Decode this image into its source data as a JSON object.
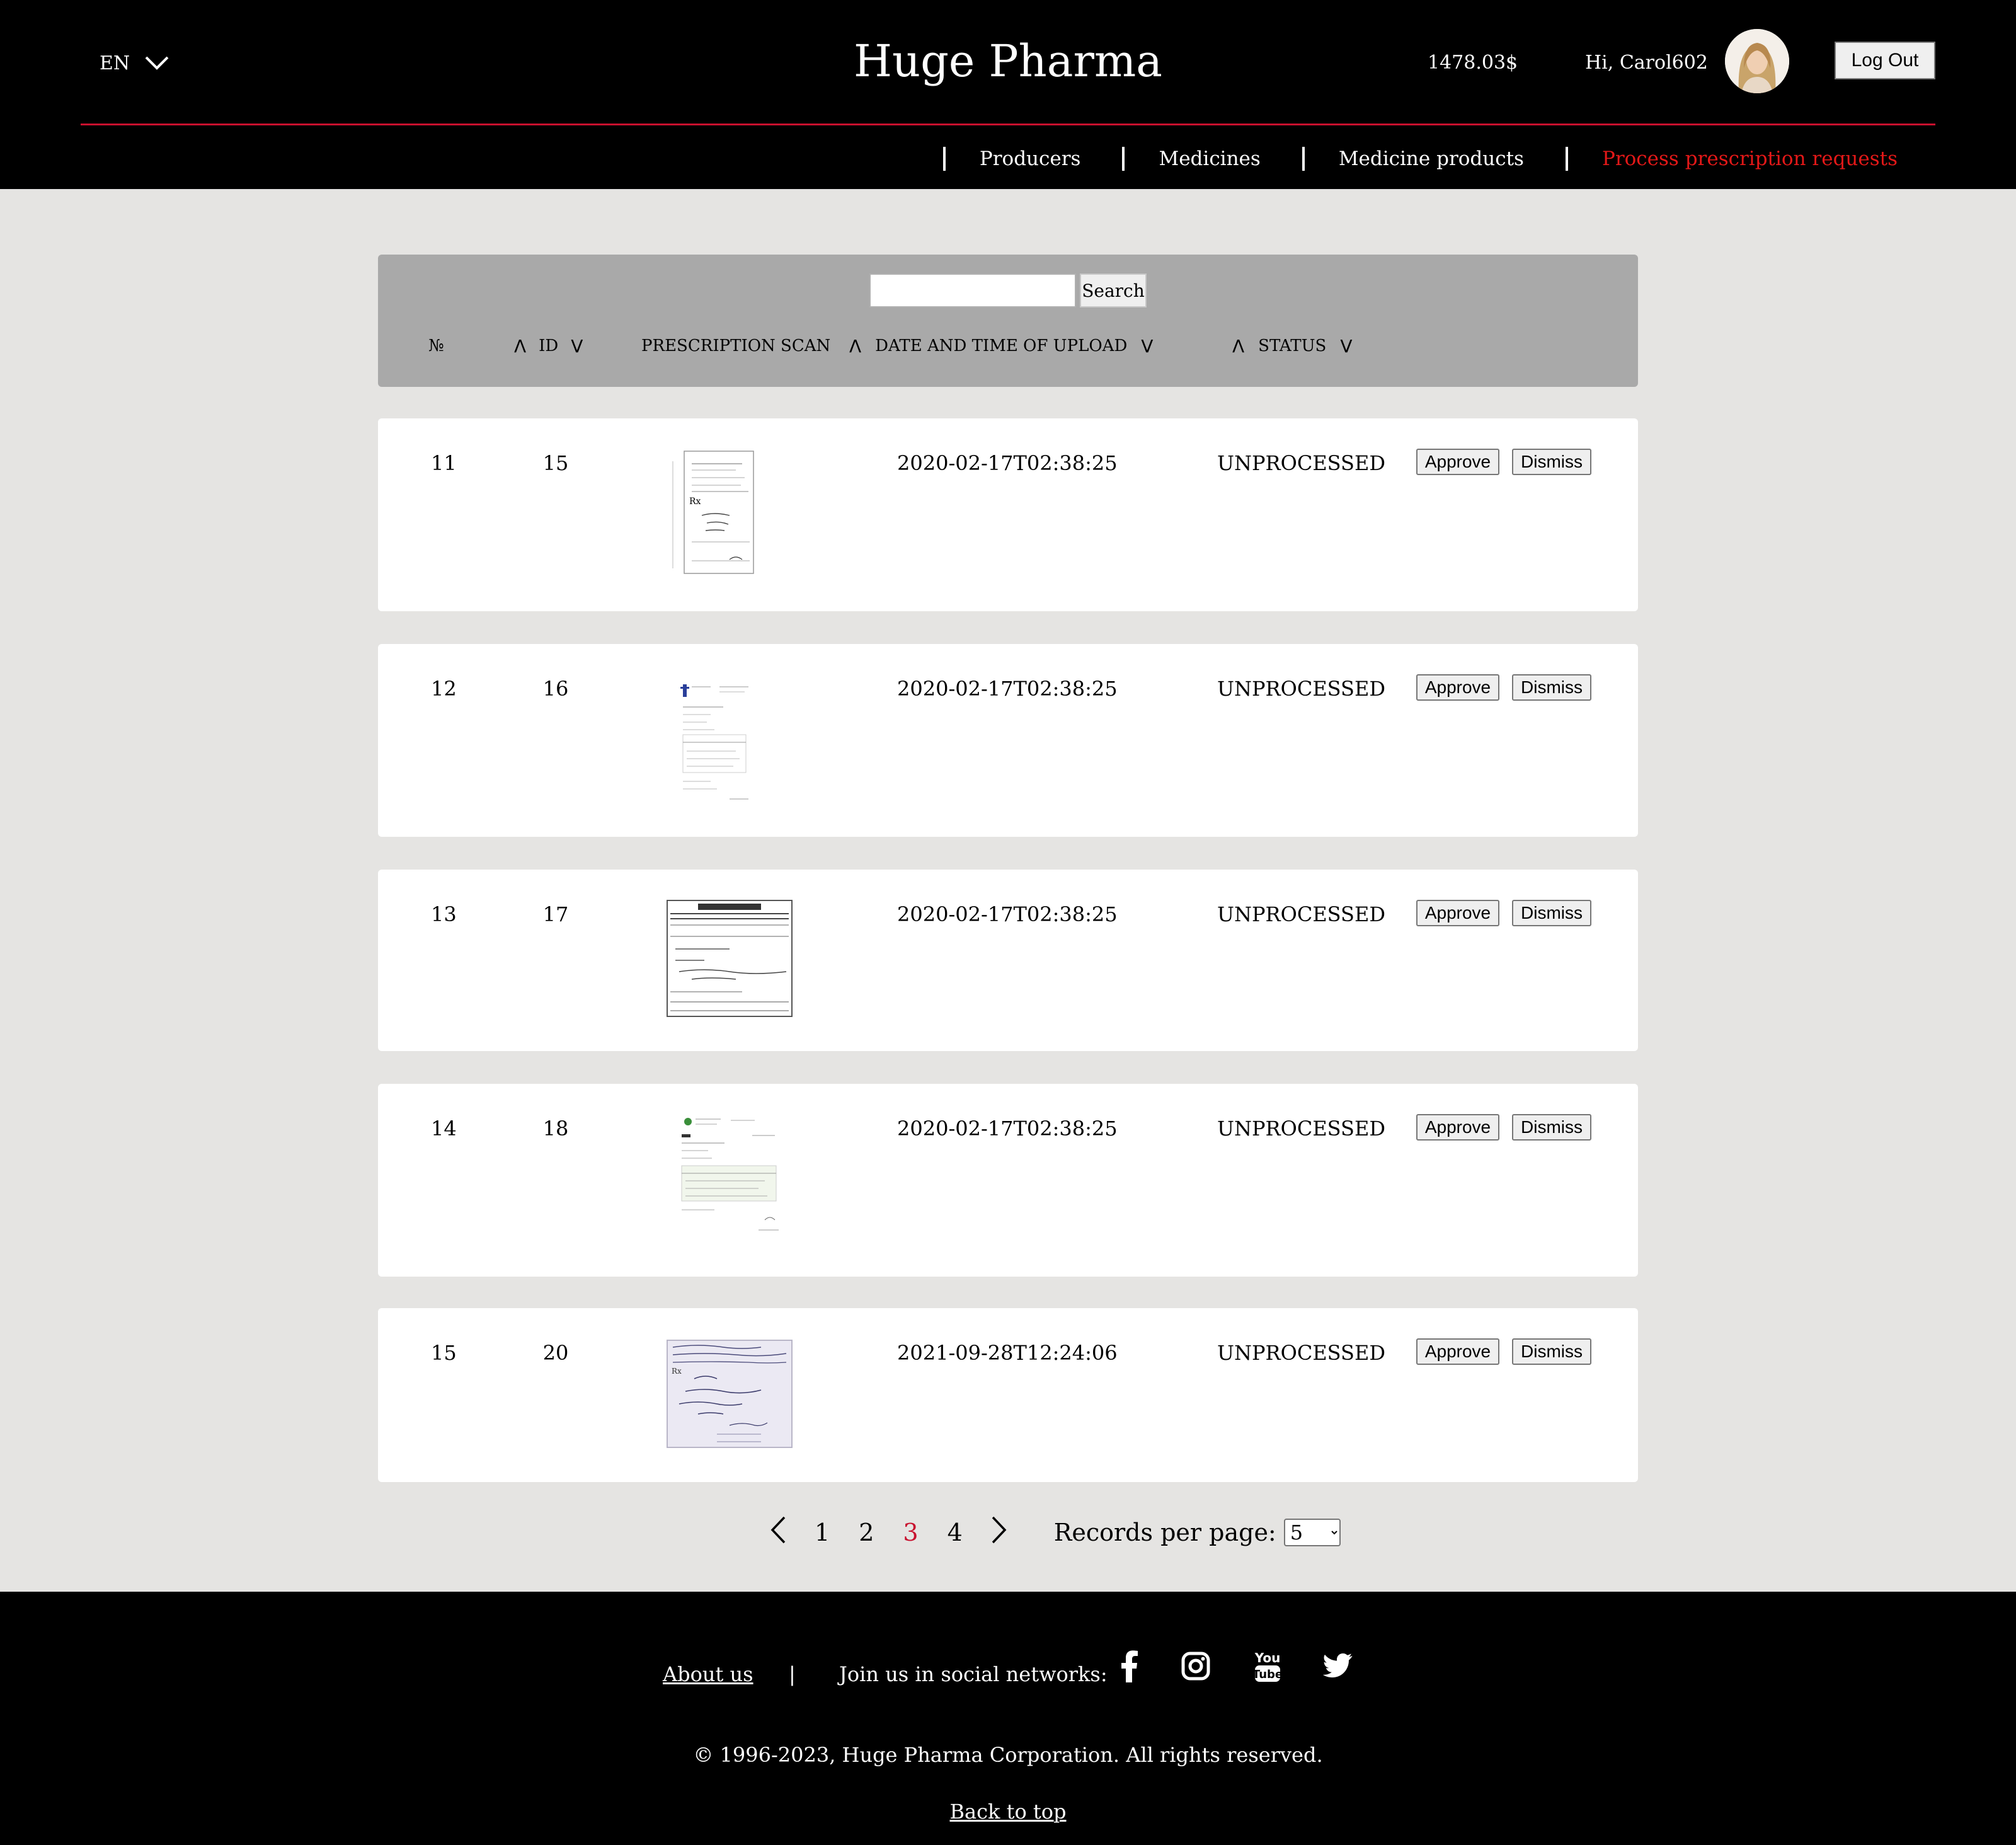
{
  "header": {
    "language": "EN",
    "brand": "Huge Pharma",
    "balance": "1478.03$",
    "greeting": "Hi, Carol602",
    "logout_label": "Log Out"
  },
  "nav": {
    "items": [
      {
        "label": "Producers"
      },
      {
        "label": "Medicines"
      },
      {
        "label": "Medicine products"
      },
      {
        "label": "Process prescription requests",
        "active": true
      }
    ]
  },
  "search": {
    "value": "",
    "button_label": "Search"
  },
  "table": {
    "columns": {
      "no": "№",
      "id": "ID",
      "scan": "PRESCRIPTION SCAN",
      "date": "DATE AND TIME OF UPLOAD",
      "status": "STATUS"
    },
    "sort_up_glyph": "Λ",
    "sort_down_glyph": "V",
    "approve_label": "Approve",
    "dismiss_label": "Dismiss",
    "rows": [
      {
        "no": "11",
        "id": "15",
        "uploaded": "2020-02-17T02:38:25",
        "status": "UNPROCESSED"
      },
      {
        "no": "12",
        "id": "16",
        "uploaded": "2020-02-17T02:38:25",
        "status": "UNPROCESSED"
      },
      {
        "no": "13",
        "id": "17",
        "uploaded": "2020-02-17T02:38:25",
        "status": "UNPROCESSED"
      },
      {
        "no": "14",
        "id": "18",
        "uploaded": "2020-02-17T02:38:25",
        "status": "UNPROCESSED"
      },
      {
        "no": "15",
        "id": "20",
        "uploaded": "2021-09-28T12:24:06",
        "status": "UNPROCESSED"
      }
    ]
  },
  "pagination": {
    "pages": [
      "1",
      "2",
      "3",
      "4"
    ],
    "current": "3",
    "records_label": "Records per page:",
    "records_per_page": "5"
  },
  "footer": {
    "about": "About us",
    "separator": "|",
    "join": "Join us in social networks:",
    "social": [
      "facebook-icon",
      "instagram-icon",
      "youtube-icon",
      "twitter-icon"
    ],
    "copyright": "© 1996-2023, Huge Pharma Corporation. All rights reserved.",
    "back_to_top": "Back to top"
  },
  "colors": {
    "accent": "#c8102e",
    "header_bg": "#000000",
    "page_bg": "#e5e4e2",
    "table_head_bg": "#a9a9a9"
  }
}
